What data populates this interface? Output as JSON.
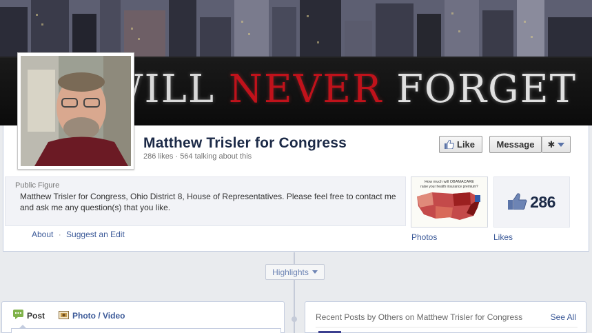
{
  "cover": {
    "banner_words": [
      "WILL",
      "NEVER",
      "FORGET"
    ]
  },
  "page": {
    "name": "Matthew Trisler for Congress",
    "stats": "286 likes · 564 talking about this"
  },
  "actions": {
    "like_label": "Like",
    "message_label": "Message"
  },
  "info": {
    "category": "Public Figure",
    "description": "Matthew Trisler for Congress, Ohio District 8, House of Representatives. Please feel free to contact me and ask me any question(s) that you like.",
    "about_label": "About",
    "separator": "·",
    "suggest_label": "Suggest an Edit"
  },
  "apps": {
    "photos_label": "Photos",
    "photos_thumb_text_1": "How much will OBAMACARE",
    "photos_thumb_text_2": "raise your health insurance premium?",
    "likes_count": "286",
    "likes_label": "Likes"
  },
  "timeline": {
    "highlights_label": "Highlights"
  },
  "composer": {
    "post_label": "Post",
    "photo_video_label": "Photo / Video"
  },
  "recent_posts": {
    "title": "Recent Posts by Others on Matthew Trisler for Congress",
    "see_all_label": "See All"
  },
  "colors": {
    "link": "#3b5998",
    "name": "#1c2a47",
    "banner_red": "#c0121b"
  },
  "icons": {
    "like": "thumbs-up-icon",
    "gear": "gear-icon",
    "post": "speech-bubble-icon",
    "photo": "camera-icon",
    "likes_box": "thumbs-up-icon"
  }
}
